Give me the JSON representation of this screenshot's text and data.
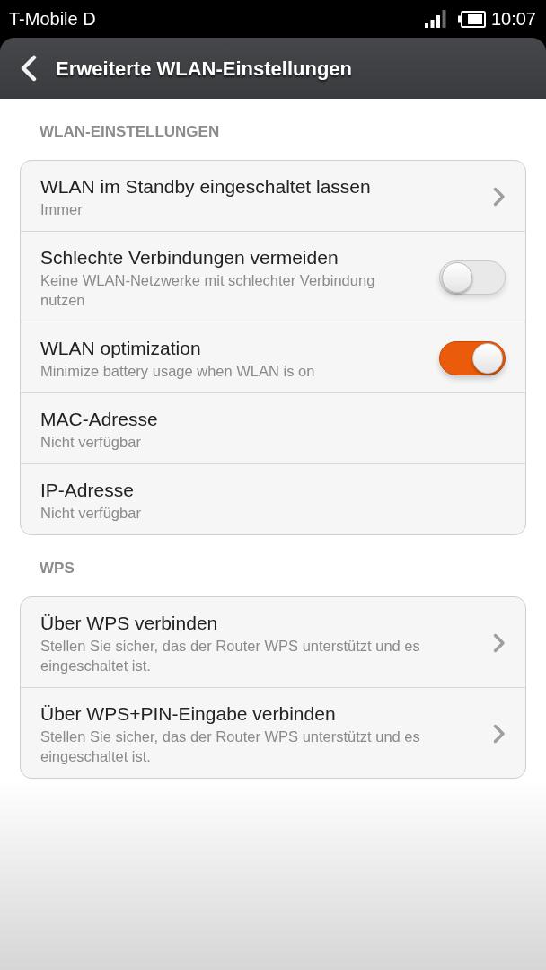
{
  "status_bar": {
    "carrier": "T-Mobile D",
    "time": "10:07"
  },
  "app_bar": {
    "title": "Erweiterte WLAN-Einstellungen"
  },
  "sections": [
    {
      "title": "WLAN-EINSTELLUNGEN",
      "rows": [
        {
          "kind": "nav",
          "title": "WLAN im Standby eingeschaltet lassen",
          "subtitle": "Immer"
        },
        {
          "kind": "toggle",
          "title": "Schlechte Verbindungen vermeiden",
          "subtitle": "Keine WLAN-Netzwerke mit schlechter Verbindung nutzen",
          "on": false
        },
        {
          "kind": "toggle",
          "title": "WLAN optimization",
          "subtitle": "Minimize battery usage when WLAN is on",
          "on": true
        },
        {
          "kind": "info",
          "title": "MAC-Adresse",
          "subtitle": "Nicht verfügbar"
        },
        {
          "kind": "info",
          "title": "IP-Adresse",
          "subtitle": "Nicht verfügbar"
        }
      ]
    },
    {
      "title": "WPS",
      "rows": [
        {
          "kind": "nav",
          "title": "Über WPS verbinden",
          "subtitle": "Stellen Sie sicher, das der Router WPS unterstützt und es eingeschaltet ist."
        },
        {
          "kind": "nav",
          "title": "Über WPS+PIN-Eingabe verbinden",
          "subtitle": "Stellen Sie sicher, das der Router WPS unterstützt und es eingeschaltet ist."
        }
      ]
    }
  ]
}
